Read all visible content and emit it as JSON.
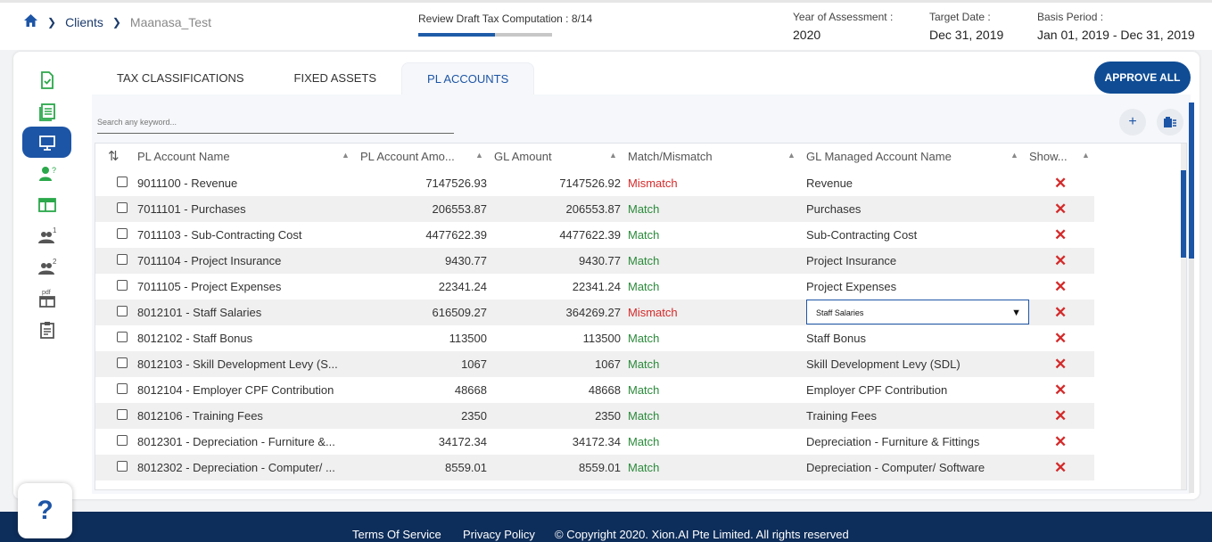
{
  "breadcrumb": {
    "home_icon": "home-icon",
    "clients": "Clients",
    "client": "Maanasa_Test"
  },
  "progress": {
    "label": "Review Draft Tax Computation : 8/14",
    "fraction": 0.571
  },
  "meta": {
    "year_label": "Year of Assessment :",
    "year_value": "2020",
    "target_label": "Target Date :",
    "target_value": "Dec 31, 2019",
    "basis_label": "Basis Period :",
    "basis_value": "Jan 01, 2019 - Dec 31, 2019"
  },
  "sidebar": [
    "doc-check-icon",
    "ledger-icon",
    "monitor-icon",
    "user-question-icon",
    "table-icon",
    "users-1-icon",
    "users-2-icon",
    "pdf-icon",
    "clipboard-icon"
  ],
  "sidebar_badges": {
    "users1": "1",
    "users2": "2",
    "user_q": "?",
    "pdf": "pdf"
  },
  "tabs": [
    "TAX CLASSIFICATIONS",
    "FIXED ASSETS",
    "PL ACCOUNTS"
  ],
  "approve_label": "APPROVE ALL",
  "search_placeholder": "Search any keyword...",
  "columns": [
    "PL Account Name",
    "PL Account Amo...",
    "GL Amount",
    "Match/Mismatch",
    "GL Managed Account Name",
    "Show..."
  ],
  "rows": [
    {
      "name": "9011100 - Revenue",
      "amount": "7147526.93",
      "gl": "7147526.92",
      "status": "Mismatch",
      "gl_name": "Revenue"
    },
    {
      "name": "7011101 - Purchases",
      "amount": "206553.87",
      "gl": "206553.87",
      "status": "Match",
      "gl_name": "Purchases"
    },
    {
      "name": "7011103 - Sub-Contracting Cost",
      "amount": "4477622.39",
      "gl": "4477622.39",
      "status": "Match",
      "gl_name": "Sub-Contracting Cost"
    },
    {
      "name": "7011104 - Project Insurance",
      "amount": "9430.77",
      "gl": "9430.77",
      "status": "Match",
      "gl_name": "Project Insurance"
    },
    {
      "name": "7011105 - Project Expenses",
      "amount": "22341.24",
      "gl": "22341.24",
      "status": "Match",
      "gl_name": "Project Expenses"
    },
    {
      "name": "8012101 - Staff Salaries",
      "amount": "616509.27",
      "gl": "364269.27",
      "status": "Mismatch",
      "gl_name": "Staff Salaries",
      "dropdown": true
    },
    {
      "name": "8012102 - Staff Bonus",
      "amount": "113500",
      "gl": "113500",
      "status": "Match",
      "gl_name": "Staff Bonus"
    },
    {
      "name": "8012103 - Skill Development Levy (S...",
      "amount": "1067",
      "gl": "1067",
      "status": "Match",
      "gl_name": "Skill Development Levy (SDL)"
    },
    {
      "name": "8012104 - Employer CPF Contribution",
      "amount": "48668",
      "gl": "48668",
      "status": "Match",
      "gl_name": "Employer CPF Contribution"
    },
    {
      "name": "8012106 - Training Fees",
      "amount": "2350",
      "gl": "2350",
      "status": "Match",
      "gl_name": "Training Fees"
    },
    {
      "name": "8012301 - Depreciation - Furniture &...",
      "amount": "34172.34",
      "gl": "34172.34",
      "status": "Match",
      "gl_name": "Depreciation - Furniture & Fittings"
    },
    {
      "name": "8012302 - Depreciation - Computer/ ...",
      "amount": "8559.01",
      "gl": "8559.01",
      "status": "Match",
      "gl_name": "Depreciation - Computer/ Software"
    }
  ],
  "footer": {
    "terms": "Terms Of Service",
    "privacy": "Privacy Policy",
    "copyright": "© Copyright 2020. Xion.AI Pte Limited. All rights reserved"
  },
  "help_label": "?",
  "colors": {
    "primary": "#1d55a6",
    "dark": "#0d2d5a",
    "mismatch": "#d42a2a",
    "match": "#2a8a3a"
  }
}
